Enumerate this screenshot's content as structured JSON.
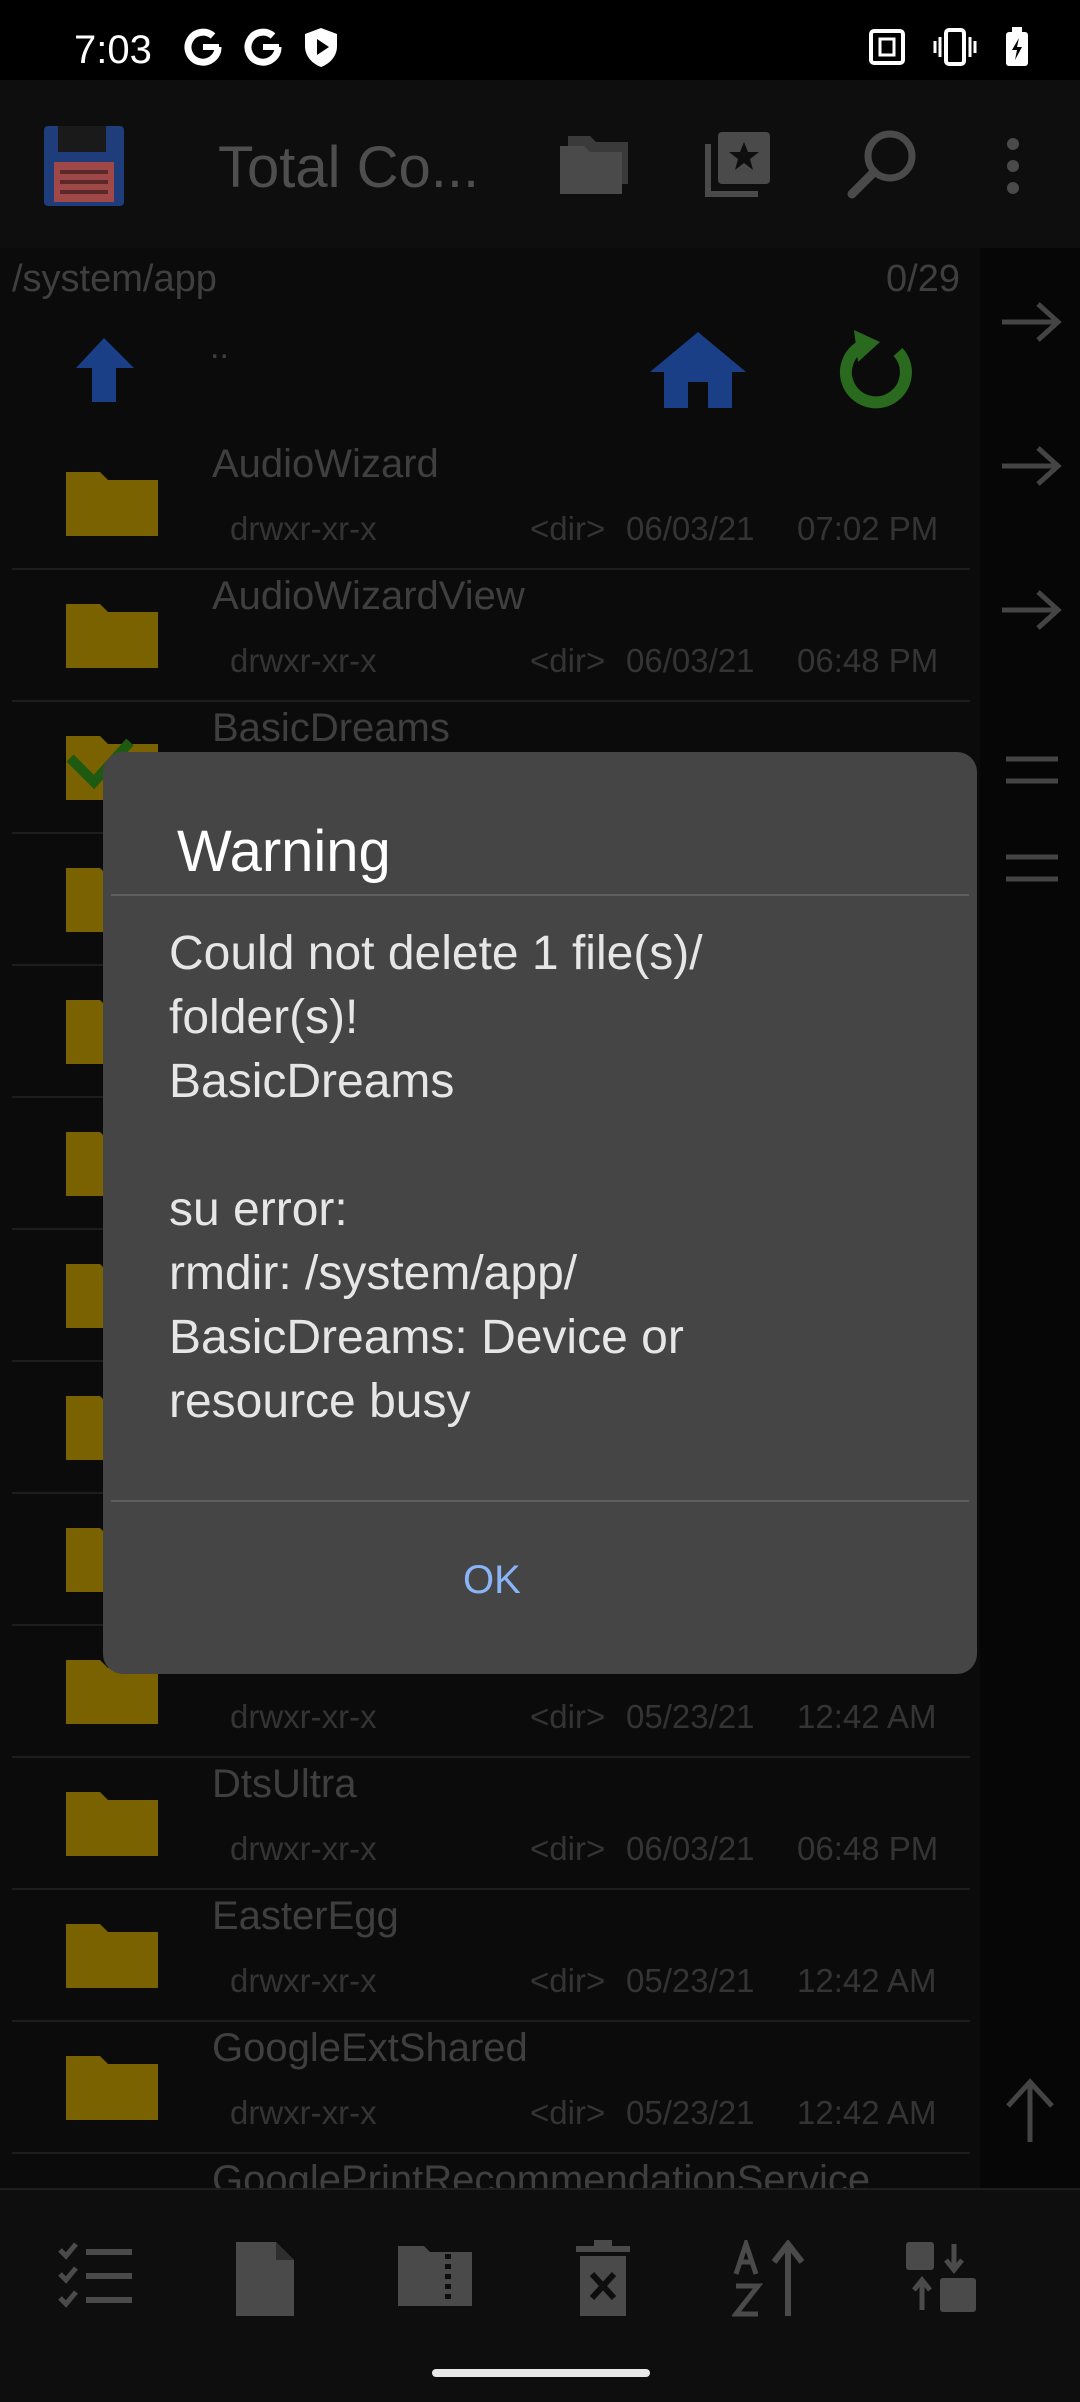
{
  "status": {
    "time": "7:03"
  },
  "app": {
    "title": "Total Co..."
  },
  "path": {
    "current": "/system/app",
    "count": "0/29",
    "updir": ".."
  },
  "files": [
    {
      "name": "AudioWizard",
      "perm": "drwxr-xr-x",
      "type": "<dir>",
      "date": "06/03/21",
      "time": "07:02 PM"
    },
    {
      "name": "AudioWizardView",
      "perm": "drwxr-xr-x",
      "type": "<dir>",
      "date": "06/03/21",
      "time": "06:48 PM"
    },
    {
      "name": "BasicDreams",
      "perm": "",
      "type": "",
      "date": "",
      "time": ""
    },
    {
      "name": "",
      "perm": "",
      "type": "",
      "date": "",
      "time": ""
    },
    {
      "name": "",
      "perm": "",
      "type": "",
      "date": "",
      "time": ""
    },
    {
      "name": "",
      "perm": "",
      "type": "",
      "date": "",
      "time": ""
    },
    {
      "name": "",
      "perm": "",
      "type": "",
      "date": "",
      "time": ""
    },
    {
      "name": "",
      "perm": "",
      "type": "",
      "date": "",
      "time": ""
    },
    {
      "name": "",
      "perm": "",
      "type": "",
      "date": "",
      "time": ""
    },
    {
      "name": "",
      "perm": "drwxr-xr-x",
      "type": "<dir>",
      "date": "05/23/21",
      "time": "12:42 AM"
    },
    {
      "name": "DtsUltra",
      "perm": "drwxr-xr-x",
      "type": "<dir>",
      "date": "06/03/21",
      "time": "06:48 PM"
    },
    {
      "name": "EasterEgg",
      "perm": "drwxr-xr-x",
      "type": "<dir>",
      "date": "05/23/21",
      "time": "12:42 AM"
    },
    {
      "name": "GoogleExtShared",
      "perm": "drwxr-xr-x",
      "type": "<dir>",
      "date": "05/23/21",
      "time": "12:42 AM"
    },
    {
      "name": "GooglePrintRecommendationService",
      "perm": "",
      "type": "",
      "date": "",
      "time": ""
    }
  ],
  "dialog": {
    "title": "Warning",
    "message": "Could not delete 1 file(s)/\nfolder(s)!\nBasicDreams\n\nsu error:\nrmdir: /system/app/\nBasicDreams: Device or\nresource busy",
    "ok_label": "OK"
  },
  "colors": {
    "folder": "#7a6200",
    "accent": "#8ab4f8",
    "home": "#1b3f86",
    "refresh": "#2a6a1e"
  }
}
